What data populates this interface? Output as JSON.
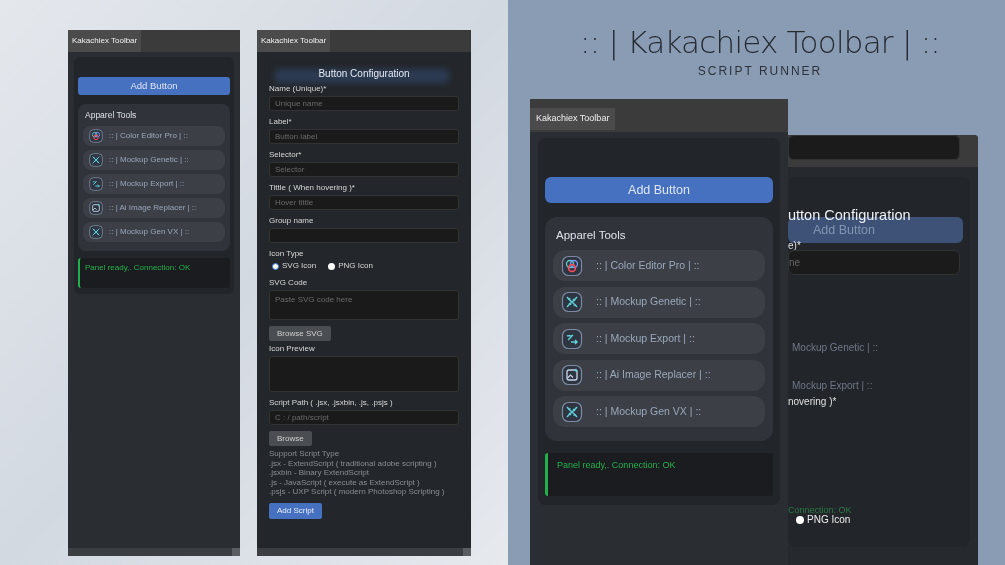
{
  "hero": {
    "title": ":: | Kakachiex Toolbar | ::",
    "subtitle": "SCRIPT RUNNER"
  },
  "toolbar_panels": [
    {
      "tab": "Kakachiex Toolbar",
      "add_button": "Add Button",
      "group": {
        "title": "Apparel Tools",
        "items": [
          {
            "label": ":: | Color Editor Pro | ::",
            "kind": "palette"
          },
          {
            "label": ":: | Mockup Genetic | ::",
            "kind": "dna"
          },
          {
            "label": ":: | Mockup Export | ::",
            "kind": "export"
          },
          {
            "label": ":: | Ai Image Replacer | ::",
            "kind": "image"
          },
          {
            "label": ":: | Mockup Gen VX | ::",
            "kind": "dna"
          }
        ]
      },
      "status": "Panel ready,. Connection: OK"
    },
    {
      "tab": "Kakachiex Toolbar",
      "add_button": "Add Button",
      "group": {
        "title": "Apparel Tools",
        "items": [
          {
            "label": ":: | Color Editor Pro | ::",
            "kind": "palette"
          },
          {
            "label": ":: | Mockup Genetic | ::",
            "kind": "dna"
          },
          {
            "label": ":: | Mockup Export | ::",
            "kind": "export"
          },
          {
            "label": ":: | Ai Image Replacer | ::",
            "kind": "image"
          },
          {
            "label": ":: | Mockup Gen VX | ::",
            "kind": "dna"
          }
        ]
      },
      "status": "Panel ready,. Connection: OK"
    }
  ],
  "config_panel": {
    "tab": "Kakachiex Toolbar",
    "title": "Button Configuration",
    "rows": [
      {
        "kind": "field",
        "label": "Name (Unique)*",
        "placeholder": "Unique name"
      },
      {
        "kind": "field",
        "label": "Label*",
        "placeholder": "Button label"
      },
      {
        "kind": "field",
        "label": "Selector*",
        "placeholder": "Selector"
      },
      {
        "kind": "field",
        "label": "Tittle ( When hovering )*",
        "placeholder": "Hover tittle"
      },
      {
        "kind": "field",
        "label": "Group name"
      },
      {
        "kind": "radios",
        "label": "Icon Type",
        "options": [
          {
            "label": "SVG Icon",
            "selected": true
          },
          {
            "label": "PNG Icon",
            "selected": false
          }
        ]
      },
      {
        "kind": "textarea",
        "label": "SVG Code",
        "placeholder": "Paste SVG code here"
      },
      {
        "kind": "button",
        "text": "Browse SVG"
      },
      {
        "kind": "preview",
        "label": "Icon Preview"
      },
      {
        "kind": "field",
        "label": "Script Path ( .jsx, .jsxbin, .js, .psjs )",
        "placeholder": "C : / path/script"
      },
      {
        "kind": "button",
        "text": "Browse"
      },
      {
        "kind": "notes",
        "lines": [
          "Support Script Type",
          ".jsx - ExtendScript ( traditional adobe scripting )",
          ".jsxbin - Binary ExtendScript",
          ".js - JavaScript ( execute as ExtendScript )",
          ".psjs - UXP Script ( modern Photoshop Scripting )"
        ]
      },
      {
        "kind": "primary",
        "text": "Add Script"
      }
    ]
  },
  "back_panel": {
    "title": "utton Configuration",
    "ghost_button": "Add Button",
    "label_1": "e)*",
    "placeholder_1": "ne",
    "ghost_item_1": "Mockup Genetic | ::",
    "ghost_item_2": "Mockup Export | ::",
    "label_2": "novering )*",
    "ghost_status": "Connection: OK",
    "radio": {
      "label": "PNG Icon",
      "selected": false
    }
  }
}
